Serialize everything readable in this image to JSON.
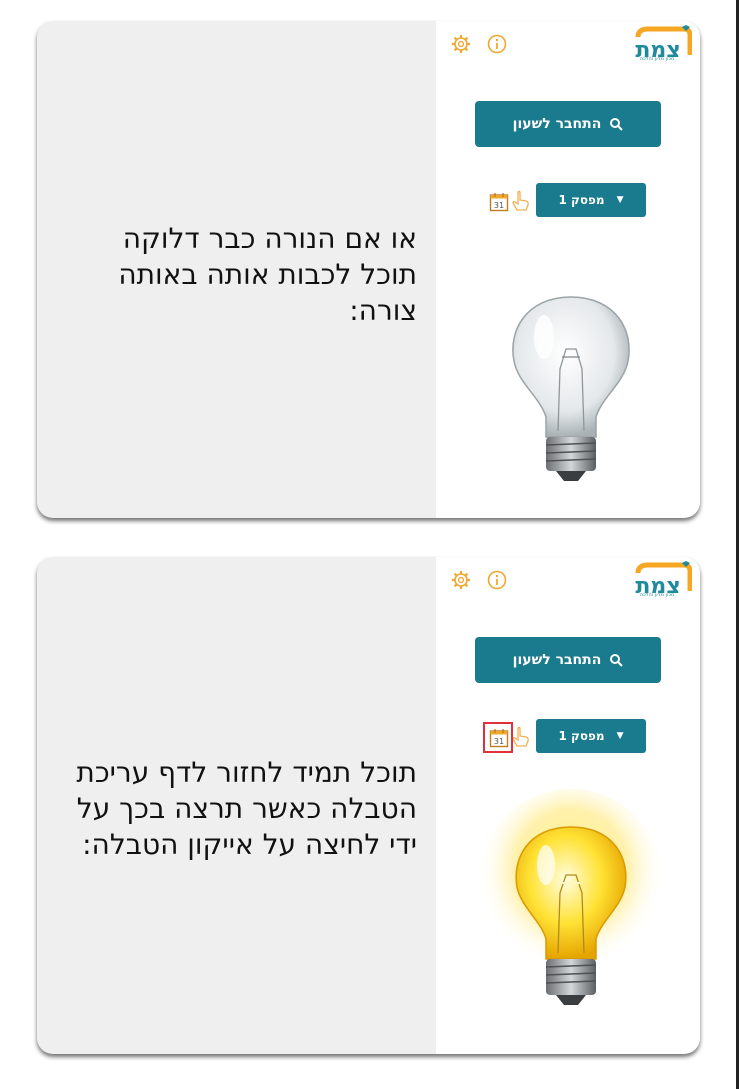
{
  "slides": [
    {
      "caption_lines": [
        "או אם הנורה כבר דלוקה",
        "תוכל לכבות אותה באותה",
        "צורה:"
      ],
      "bulb_state": "off",
      "calendar_highlighted": false
    },
    {
      "caption_lines": [
        "תוכל תמיד לחזור לדף עריכת",
        "הטבלה כאשר תרצה בכך על",
        "ידי לחיצה על אייקון הטבלה:"
      ],
      "bulb_state": "on",
      "calendar_highlighted": true
    }
  ],
  "app": {
    "logo_text": "צמת",
    "logo_subtitle": "מכון מדע והלכה",
    "connect_label": "התחבר לשעון",
    "switch_label": "מפסק 1",
    "calendar_day": "31",
    "icons": [
      "settings-gear-icon",
      "info-icon",
      "search-icon",
      "chevron-down-icon",
      "calendar-icon",
      "hand-pointer-icon",
      "light-bulb-icon"
    ]
  },
  "colors": {
    "brand_teal": "#1a7a8e",
    "logo_orange": "#f5a623",
    "highlight_red": "#e0303a",
    "bulb_glow": "#ffe14a"
  }
}
